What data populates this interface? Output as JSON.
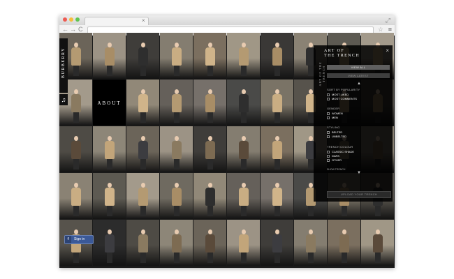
{
  "browser": {
    "tab_close": "×",
    "back_icon": "←",
    "forward_icon": "→",
    "reload_icon": "C",
    "star_icon": "☆",
    "menu_icon": "≡",
    "expand_icon": "⤢"
  },
  "sidebar": {
    "brand": "BURBERRY",
    "music_icon": "♫"
  },
  "about_label": "ABOUT",
  "signin": {
    "fb_icon": "f",
    "label": "Sign in"
  },
  "panel": {
    "close": "×",
    "title_line1": "ART OF",
    "title_line2": "THE TRENCH",
    "vertical_text": "ART OF THE TRENCH",
    "view_all": "VIEW ALL",
    "view_latest": "VIEW LATEST",
    "up_arrow": "▲",
    "down_arrow": "▼",
    "sort_heading": "SORT BY POPULARITY",
    "sort_options": [
      "MOST LIKED",
      "MOST COMMENTS"
    ],
    "gender_heading": "GENDER",
    "gender_options": [
      "WOMEN",
      "MEN"
    ],
    "styling_heading": "STYLING",
    "styling_options": [
      "BELTED",
      "UNBELTED"
    ],
    "colour_heading": "TRENCH COLOUR",
    "colour_options": [
      "CLASSIC SHADE",
      "DARK",
      "OTHER"
    ],
    "show_link": "SHOW TRENCH",
    "upload_button": "UPLOAD YOUR TRENCH"
  }
}
